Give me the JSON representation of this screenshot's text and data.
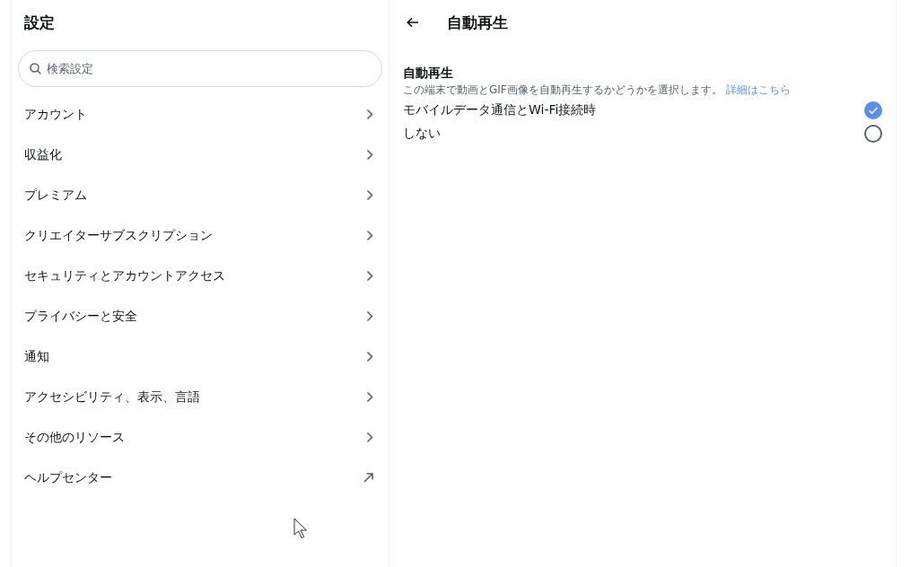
{
  "sidebar": {
    "title": "設定",
    "search": {
      "placeholder": "検索設定"
    },
    "items": [
      {
        "label": "アカウント",
        "kind": "chevron"
      },
      {
        "label": "収益化",
        "kind": "chevron"
      },
      {
        "label": "プレミアム",
        "kind": "chevron"
      },
      {
        "label": "クリエイターサブスクリプション",
        "kind": "chevron"
      },
      {
        "label": "セキュリティとアカウントアクセス",
        "kind": "chevron"
      },
      {
        "label": "プライバシーと安全",
        "kind": "chevron"
      },
      {
        "label": "通知",
        "kind": "chevron"
      },
      {
        "label": "アクセシビリティ、表示、言語",
        "kind": "chevron"
      },
      {
        "label": "その他のリソース",
        "kind": "chevron"
      },
      {
        "label": "ヘルプセンター",
        "kind": "external"
      }
    ]
  },
  "detail": {
    "title": "自動再生",
    "section": {
      "heading": "自動再生",
      "description": "この端末で動画とGIF画像を自動再生するかどうかを選択します。",
      "link": "詳細はこちら"
    },
    "options": [
      {
        "label": "モバイルデータ通信とWi-Fi接続時",
        "selected": true
      },
      {
        "label": "しない",
        "selected": false
      }
    ]
  }
}
